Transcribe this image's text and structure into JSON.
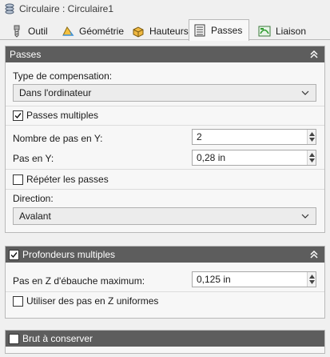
{
  "window": {
    "title": "Circulaire : Circulaire1"
  },
  "tabs": [
    {
      "label": "Outil",
      "icon": "tool-icon",
      "active": false
    },
    {
      "label": "Géométrie",
      "icon": "geometry-icon",
      "active": false
    },
    {
      "label": "Hauteurs",
      "icon": "heights-icon",
      "active": false
    },
    {
      "label": "Passes",
      "icon": "passes-icon",
      "active": true
    },
    {
      "label": "Liaison",
      "icon": "linking-icon",
      "active": false
    }
  ],
  "passes": {
    "header": "Passes",
    "compensation_label": "Type de compensation:",
    "compensation_value": "Dans l'ordinateur",
    "multiple_passes_label": "Passes multiples",
    "multiple_passes_checked": true,
    "steps_y_label": "Nombre de pas en Y:",
    "steps_y_value": "2",
    "pitch_y_label": "Pas en Y:",
    "pitch_y_value": "0,28 in",
    "repeat_passes_label": "Répéter les passes",
    "repeat_passes_checked": false,
    "direction_label": "Direction:",
    "direction_value": "Avalant"
  },
  "depths": {
    "header": "Profondeurs multiples",
    "header_checked": true,
    "max_roughing_label": "Pas en Z d'ébauche maximum:",
    "max_roughing_value": "0,125 in",
    "uniform_steps_label": "Utiliser des pas en Z uniformes",
    "uniform_steps_checked": false
  },
  "stock": {
    "header": "Brut à conserver",
    "header_checked": false
  },
  "colors": {
    "header_bg": "#5d5d5d",
    "panel_bg": "#f7f7f7",
    "window_bg": "#f0f0f0"
  }
}
